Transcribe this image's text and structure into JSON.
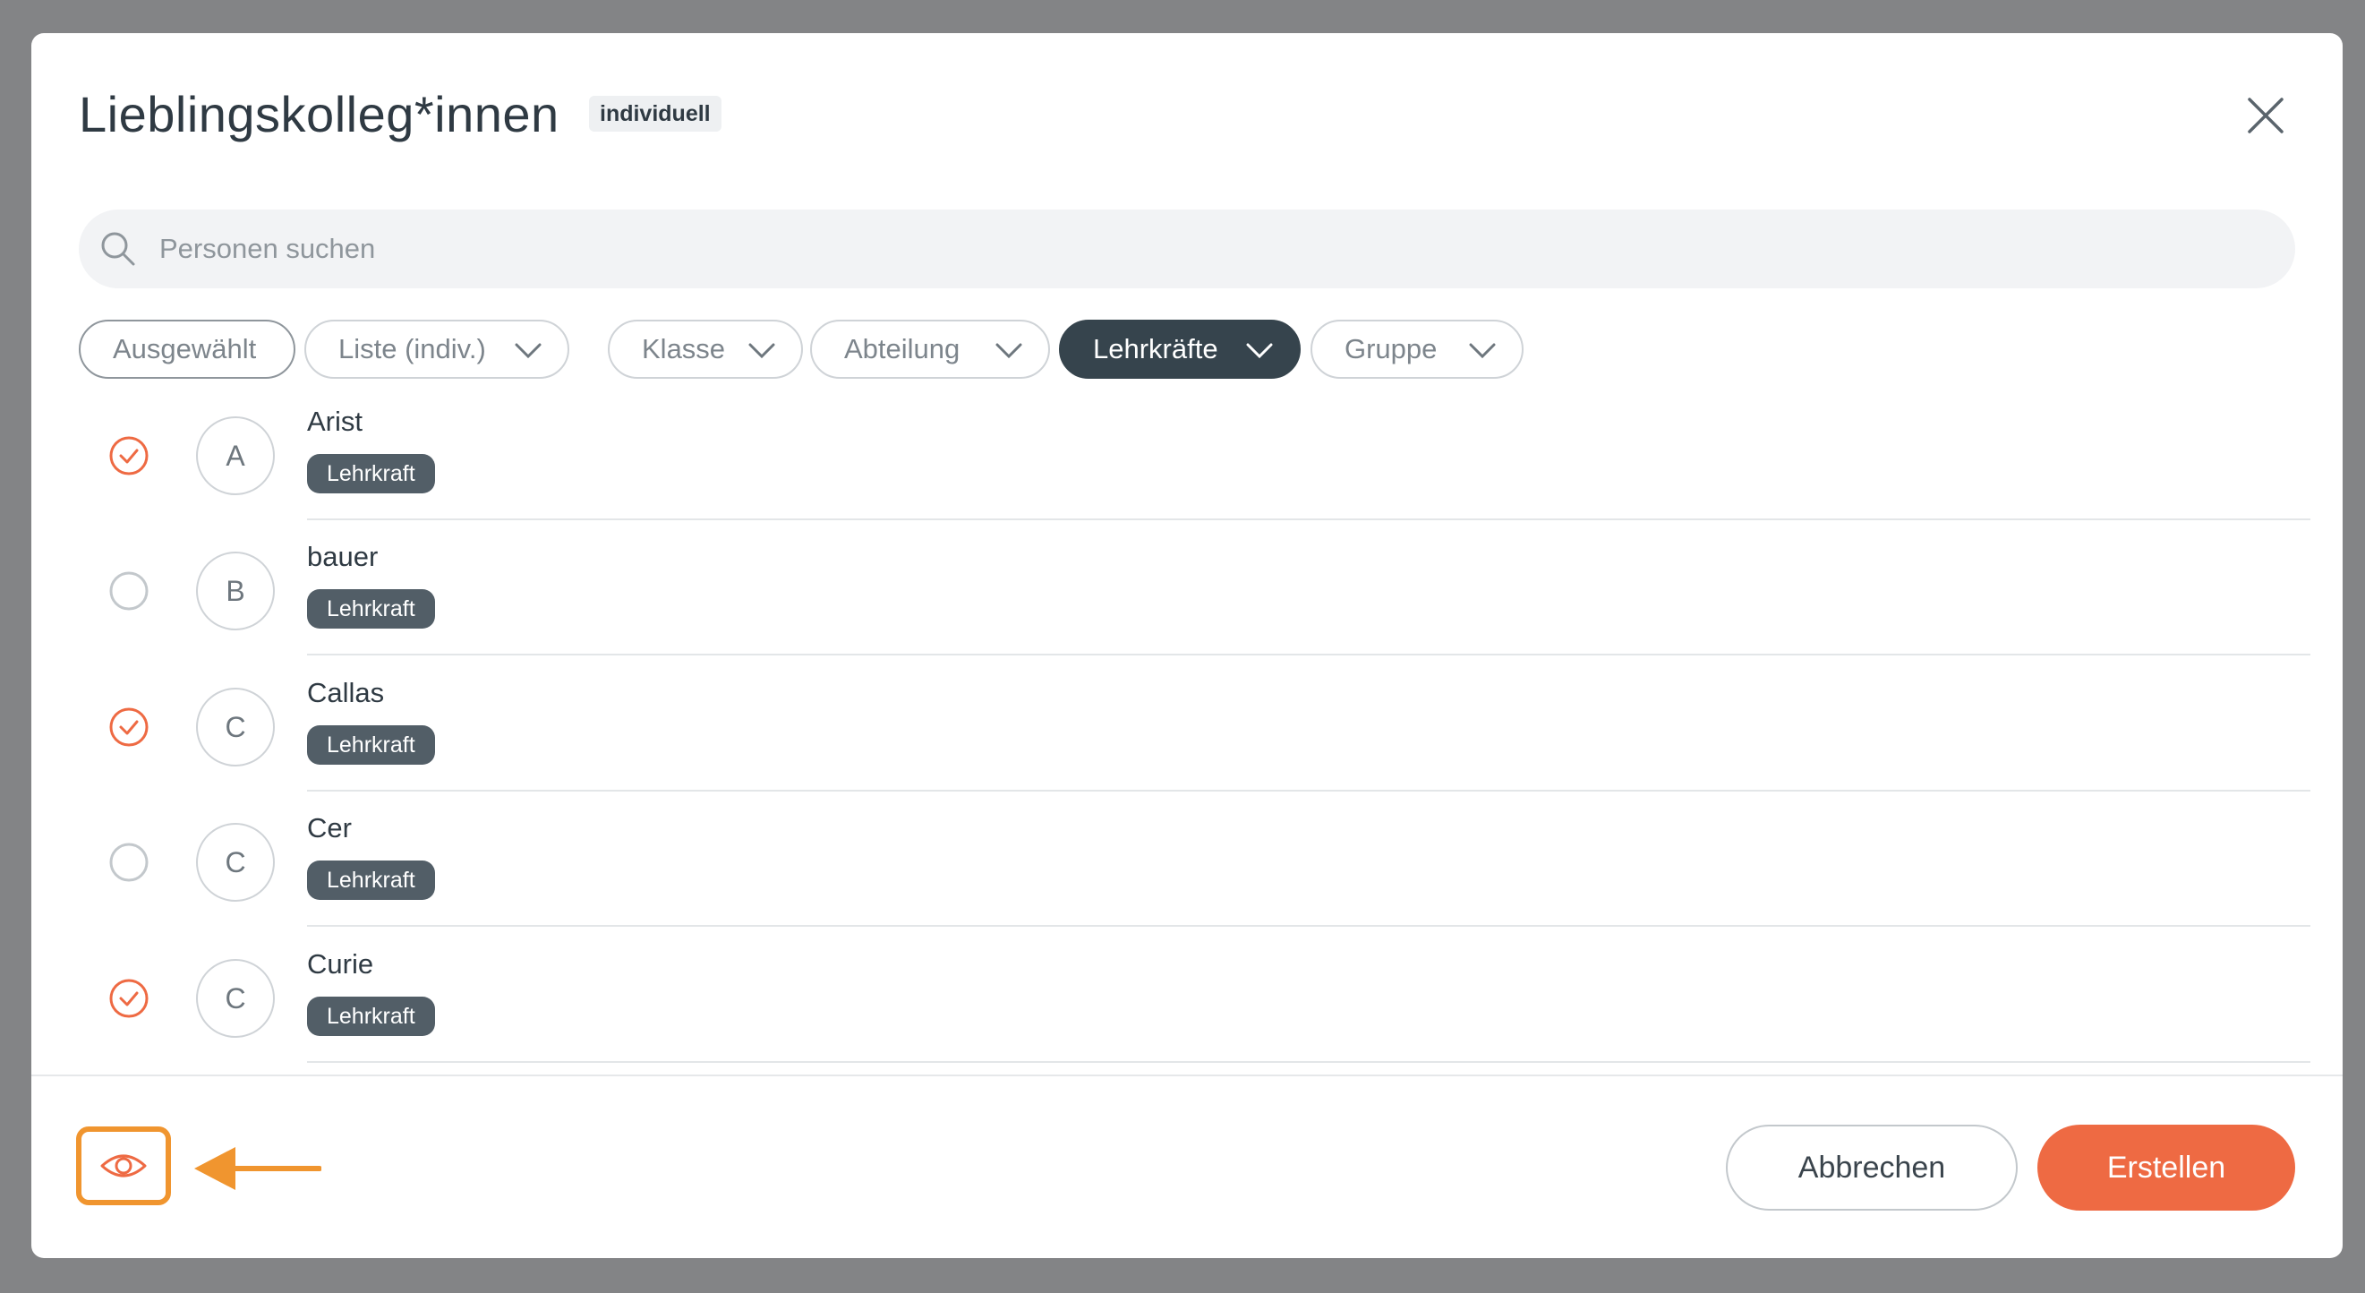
{
  "dialog": {
    "title": "Lieblingskolleg*innen",
    "badge": "individuell"
  },
  "search": {
    "placeholder": "Personen suchen",
    "value": ""
  },
  "filters": [
    {
      "label": "Ausgewählt",
      "has_dropdown": false,
      "active": false
    },
    {
      "label": "Liste (indiv.)",
      "has_dropdown": true,
      "active": false
    },
    {
      "label": "Klasse",
      "has_dropdown": true,
      "active": false
    },
    {
      "label": "Abteilung",
      "has_dropdown": true,
      "active": false
    },
    {
      "label": "Lehrkräfte",
      "has_dropdown": true,
      "active": true
    },
    {
      "label": "Gruppe",
      "has_dropdown": true,
      "active": false
    }
  ],
  "people": [
    {
      "initial": "A",
      "name": "Arist",
      "tag": "Lehrkraft",
      "selected": true
    },
    {
      "initial": "B",
      "name": "bauer",
      "tag": "Lehrkraft",
      "selected": false
    },
    {
      "initial": "C",
      "name": "Callas",
      "tag": "Lehrkraft",
      "selected": true
    },
    {
      "initial": "C",
      "name": "Cer",
      "tag": "Lehrkraft",
      "selected": false
    },
    {
      "initial": "C",
      "name": "Curie",
      "tag": "Lehrkraft",
      "selected": true
    }
  ],
  "footer": {
    "cancel_label": "Abbrechen",
    "create_label": "Erstellen"
  },
  "colors": {
    "accent": "#ee6a43",
    "highlight": "#f0952f",
    "active_chip": "#36444d",
    "tag_bg": "#525e67"
  },
  "icons": {
    "close": "close-icon",
    "search": "search-icon",
    "chevron": "chevron-down-icon",
    "checked": "check-circle-icon",
    "unchecked": "empty-circle-icon",
    "preview": "eye-icon",
    "annotation": "arrow-left-icon"
  }
}
